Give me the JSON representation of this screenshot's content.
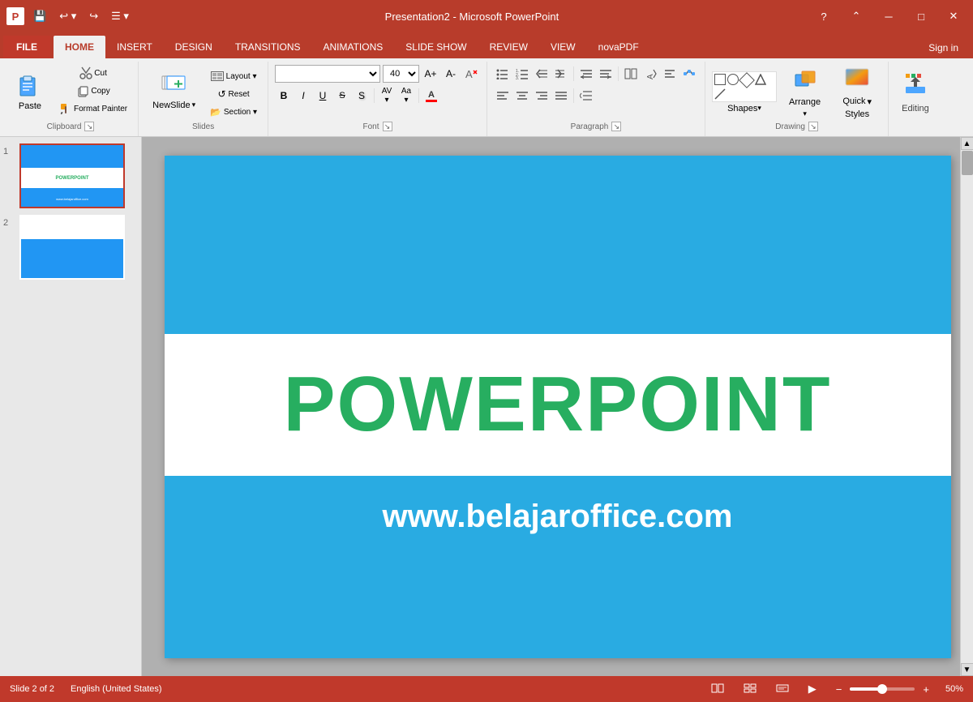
{
  "titleBar": {
    "appName": "Presentation2 - Microsoft PowerPoint",
    "quickAccess": [
      "save",
      "undo",
      "redo",
      "customize"
    ]
  },
  "tabs": [
    {
      "id": "file",
      "label": "FILE",
      "active": false
    },
    {
      "id": "home",
      "label": "HOME",
      "active": true
    },
    {
      "id": "insert",
      "label": "INSERT",
      "active": false
    },
    {
      "id": "design",
      "label": "DESIGN",
      "active": false
    },
    {
      "id": "transitions",
      "label": "TRANSITIONS",
      "active": false
    },
    {
      "id": "animations",
      "label": "ANIMATIONS",
      "active": false
    },
    {
      "id": "slideshow",
      "label": "SLIDE SHOW",
      "active": false
    },
    {
      "id": "review",
      "label": "REVIEW",
      "active": false
    },
    {
      "id": "view",
      "label": "VIEW",
      "active": false
    },
    {
      "id": "novapdf",
      "label": "novaPDF",
      "active": false
    }
  ],
  "ribbon": {
    "groups": [
      {
        "id": "clipboard",
        "label": "Clipboard",
        "buttons": [
          {
            "id": "paste",
            "label": "Paste"
          },
          {
            "id": "cut",
            "label": "Cut"
          },
          {
            "id": "copy",
            "label": "Copy"
          },
          {
            "id": "format-painter",
            "label": "Format Painter"
          }
        ]
      },
      {
        "id": "slides",
        "label": "Slides",
        "buttons": [
          {
            "id": "new-slide",
            "label": "New Slide"
          },
          {
            "id": "layout",
            "label": "Layout"
          },
          {
            "id": "reset",
            "label": "Reset"
          },
          {
            "id": "section",
            "label": "Section"
          }
        ]
      },
      {
        "id": "font",
        "label": "Font",
        "fontName": "",
        "fontSize": "40",
        "buttons": [
          "Bold",
          "Italic",
          "Underline",
          "Strikethrough",
          "Shadow",
          "ClearFormat",
          "IncreaseSize",
          "DecreaseSize",
          "FontColor"
        ]
      },
      {
        "id": "paragraph",
        "label": "Paragraph"
      },
      {
        "id": "drawing",
        "label": "Drawing",
        "buttons": [
          "Shapes",
          "Arrange",
          "Quick Styles"
        ]
      },
      {
        "id": "editing",
        "label": "Editing",
        "buttons": [
          "Editing"
        ]
      }
    ]
  },
  "slides": [
    {
      "number": 1,
      "active": true,
      "title": "POWERPOINT",
      "subtitle": "www.belajaroffice.com"
    },
    {
      "number": 2,
      "active": false,
      "title": "",
      "subtitle": ""
    }
  ],
  "currentSlide": {
    "title": "POWERPOINT",
    "subtitle": "www.belajaroffice.com"
  },
  "statusBar": {
    "slideInfo": "Slide 2 of 2",
    "language": "English (United States)",
    "zoomPercent": "50%",
    "viewModes": [
      "normal",
      "slidesorter",
      "reading",
      "slideshow"
    ]
  },
  "windowControls": {
    "minimize": "─",
    "maximize": "□",
    "close": "✕",
    "help": "?"
  },
  "signIn": "Sign in"
}
